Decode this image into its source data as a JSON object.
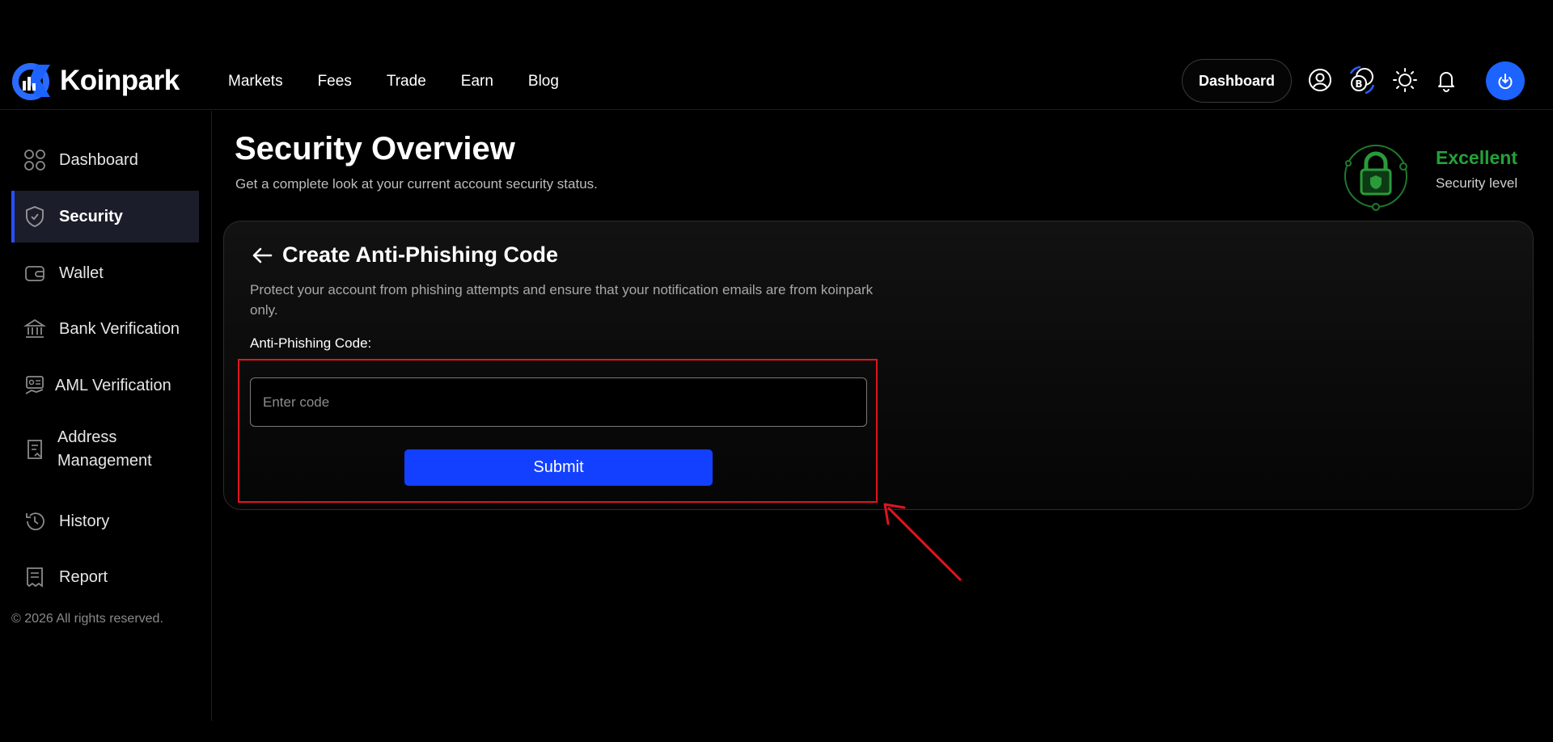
{
  "header": {
    "brand": "Koinpark",
    "nav": [
      "Markets",
      "Fees",
      "Trade",
      "Earn",
      "Blog"
    ],
    "dashboard_label": "Dashboard",
    "icons": [
      "user-circle-icon",
      "currency-exchange-icon",
      "sun-icon",
      "bell-icon",
      "power-icon"
    ]
  },
  "sidebar": {
    "items": [
      {
        "label": "Dashboard",
        "icon": "grid-icon"
      },
      {
        "label": "Security",
        "icon": "shield-icon",
        "active": true
      },
      {
        "label": "Wallet",
        "icon": "wallet-icon"
      },
      {
        "label": "Bank Verification",
        "icon": "bank-icon"
      },
      {
        "label": "AML Verification",
        "icon": "id-card-icon"
      },
      {
        "label": "Address Management",
        "line1": "Address",
        "line2": "Management",
        "icon": "address-book-icon"
      },
      {
        "label": "History",
        "icon": "history-icon"
      },
      {
        "label": "Report",
        "icon": "report-icon"
      }
    ],
    "copyright": "© 2026 All rights reserved."
  },
  "main": {
    "title": "Security Overview",
    "subtitle": "Get a complete look at your current account security status.",
    "security_level": {
      "title": "Excellent",
      "subtitle": "Security level",
      "color": "#23a23a"
    },
    "card": {
      "title": "Create Anti-Phishing Code",
      "description": "Protect your account from phishing attempts and ensure that your notification emails are from koinpark only.",
      "field_label": "Anti-Phishing Code:",
      "input_placeholder": "Enter code",
      "input_value": "",
      "submit_label": "Submit"
    }
  },
  "colors": {
    "accent": "#1340ff",
    "highlight": "#e1141e",
    "success": "#23a23a"
  }
}
